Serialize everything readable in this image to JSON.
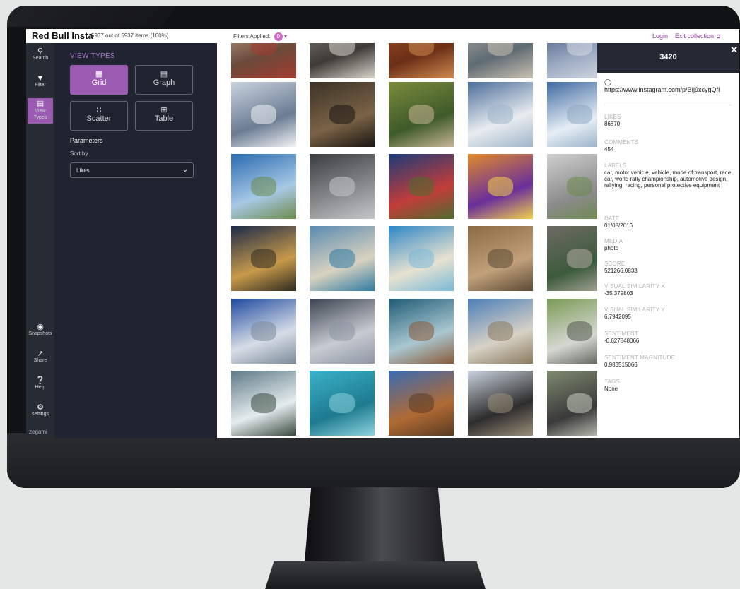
{
  "app": {
    "brand": "Red Bull Insta",
    "count": "5937 out of 5937 items (100%)",
    "filters_label": "Filters Applied:",
    "filters_count": "0",
    "login": "Login",
    "exit": "Exit collection"
  },
  "iconbar": {
    "search": "Search",
    "filter": "Filter",
    "view_types": "View Types",
    "snapshots": "Snapshots",
    "share": "Share",
    "help": "Help",
    "settings": "settings",
    "footer": "zegami"
  },
  "panel": {
    "title": "VIEW TYPES",
    "types": [
      "Grid",
      "Graph",
      "Scatter",
      "Table"
    ],
    "active": "Grid",
    "parameters": "Parameters",
    "sort_by_label": "Sort by",
    "sort_by_value": "Likes"
  },
  "detail": {
    "id": "3420",
    "url": "https://www.instagram.com/p/BIj9xcygQfI",
    "fields": [
      {
        "label": "LIKES",
        "value": "86870"
      },
      {
        "label": "COMMENTS",
        "value": "454"
      },
      {
        "label": "LABELS",
        "value": "car, motor vehicle, vehicle, mode of transport, race car, world rally championship, automotive design, rallying, racing, personal protective equipment"
      },
      {
        "label": "DATE",
        "value": "01/08/2016"
      },
      {
        "label": "MEDIA",
        "value": "photo"
      },
      {
        "label": "SCORE",
        "value": "521266.0833"
      },
      {
        "label": "VISUAL SIMILARITY X",
        "value": "-35.379803"
      },
      {
        "label": "VISUAL SIMILARITY Y",
        "value": "6.7942095"
      },
      {
        "label": "SENTIMENT",
        "value": "-0.627848066"
      },
      {
        "label": "SENTIMENT MAGNITUDE",
        "value": "0.983515066"
      },
      {
        "label": "TAGS",
        "value": "None"
      }
    ]
  },
  "colors": {
    "accent": "#9b5cb2",
    "sidebar": "#272b33",
    "panel": "#1f2430",
    "link": "#8b3d97"
  }
}
